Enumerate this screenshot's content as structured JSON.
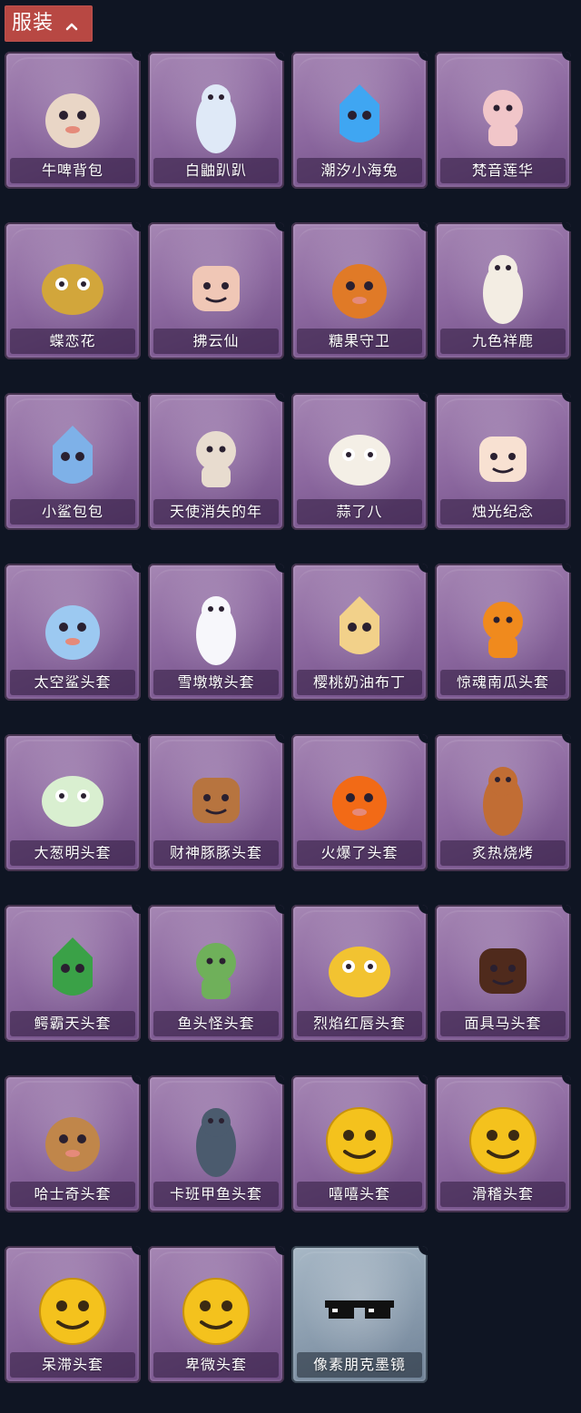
{
  "header": {
    "title": "服装",
    "chevron_icon": "chevron-up-icon",
    "color": "#b84843"
  },
  "colors": {
    "background": "#0f1523",
    "card_purple": "#8e6aa1",
    "card_special": "#8fa1b2"
  },
  "items": [
    {
      "name": "牛啤背包",
      "icon": "cow-beer-backpack-icon",
      "style": "purple",
      "color": "#e9d6c6"
    },
    {
      "name": "白鼬趴趴",
      "icon": "white-weasel-icon",
      "style": "purple",
      "color": "#dfe9f7"
    },
    {
      "name": "潮汐小海兔",
      "icon": "sea-bunny-icon",
      "style": "purple",
      "color": "#3fa6f2"
    },
    {
      "name": "梵音莲华",
      "icon": "lotus-fairy-icon",
      "style": "purple",
      "color": "#f1c6c9"
    },
    {
      "name": "蝶恋花",
      "icon": "butterfly-bell-icon",
      "style": "purple",
      "color": "#d2a63b"
    },
    {
      "name": "拂云仙",
      "icon": "cloud-fairy-icon",
      "style": "purple",
      "color": "#f0c7b6"
    },
    {
      "name": "糖果守卫",
      "icon": "candy-guard-icon",
      "style": "purple",
      "color": "#e07a27"
    },
    {
      "name": "九色祥鹿",
      "icon": "nine-color-deer-icon",
      "style": "purple",
      "color": "#f3ede3"
    },
    {
      "name": "小鲨包包",
      "icon": "shark-plush-icon",
      "style": "purple",
      "color": "#7eb1e8"
    },
    {
      "name": "天使消失的年",
      "icon": "angel-doll-icon",
      "style": "purple",
      "color": "#e8dccf"
    },
    {
      "name": "蒜了八",
      "icon": "garlic-icon",
      "style": "purple",
      "color": "#f4efe6"
    },
    {
      "name": "烛光纪念",
      "icon": "candle-icon",
      "style": "purple",
      "color": "#f8e1d2"
    },
    {
      "name": "太空鲨头套",
      "icon": "space-shark-head-icon",
      "style": "purple",
      "color": "#9cc9f1"
    },
    {
      "name": "雪墩墩头套",
      "icon": "snowman-head-icon",
      "style": "purple",
      "color": "#f7f7fb"
    },
    {
      "name": "樱桃奶油布丁",
      "icon": "pudding-icon",
      "style": "purple",
      "color": "#f2d18a"
    },
    {
      "name": "惊魂南瓜头套",
      "icon": "pumpkin-head-icon",
      "style": "purple",
      "color": "#f08a1d"
    },
    {
      "name": "大葱明头套",
      "icon": "scallion-head-icon",
      "style": "purple",
      "color": "#d9efd0"
    },
    {
      "name": "财神豚豚头套",
      "icon": "capybara-head-icon",
      "style": "purple",
      "color": "#b7743f"
    },
    {
      "name": "火爆了头套",
      "icon": "fire-head-icon",
      "style": "purple",
      "color": "#f26a16"
    },
    {
      "name": "炙热烧烤",
      "icon": "bbq-meat-icon",
      "style": "purple",
      "color": "#c16d34"
    },
    {
      "name": "鳄霸天头套",
      "icon": "crocodile-head-icon",
      "style": "purple",
      "color": "#3aa147"
    },
    {
      "name": "鱼头怪头套",
      "icon": "fish-head-icon",
      "style": "purple",
      "color": "#6fb05a"
    },
    {
      "name": "烈焰红唇头套",
      "icon": "lips-head-icon",
      "style": "purple",
      "color": "#f2c331"
    },
    {
      "name": "面具马头套",
      "icon": "horse-head-icon",
      "style": "purple",
      "color": "#4f2a1c"
    },
    {
      "name": "哈士奇头套",
      "icon": "husky-head-icon",
      "style": "purple",
      "color": "#c0864a"
    },
    {
      "name": "卡班甲鱼头套",
      "icon": "turtle-head-icon",
      "style": "purple",
      "color": "#4b5b6e"
    },
    {
      "name": "嘻嘻头套",
      "icon": "grin-emoji-head-icon",
      "style": "purple",
      "color": "#f4c21d"
    },
    {
      "name": "滑稽头套",
      "icon": "sly-emoji-head-icon",
      "style": "purple",
      "color": "#f4c21d"
    },
    {
      "name": "呆滞头套",
      "icon": "dazed-emoji-head-icon",
      "style": "purple",
      "color": "#f4c21d"
    },
    {
      "name": "卑微头套",
      "icon": "humble-emoji-head-icon",
      "style": "purple",
      "color": "#f4c21d"
    },
    {
      "name": "像素朋克墨镜",
      "icon": "pixel-sunglasses-icon",
      "style": "special",
      "color": "#111111"
    }
  ]
}
